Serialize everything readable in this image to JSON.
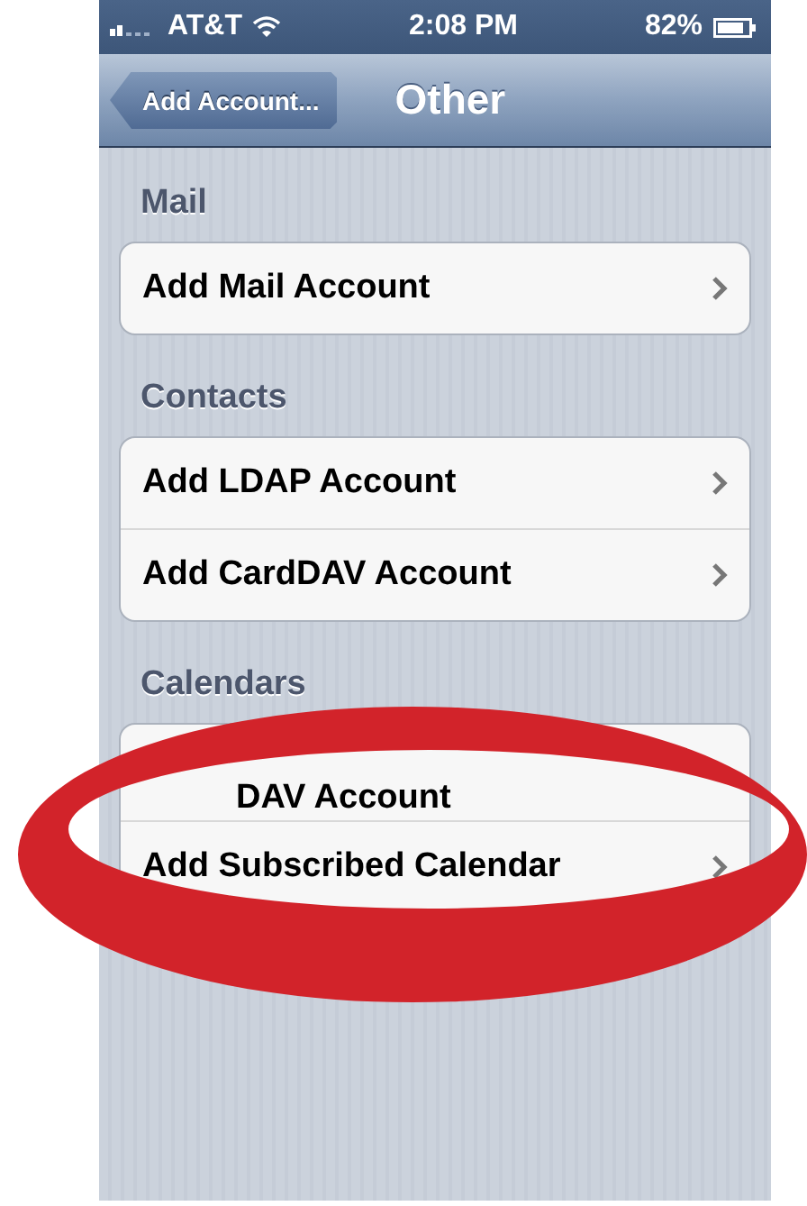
{
  "status_bar": {
    "carrier": "AT&T",
    "time": "2:08 PM",
    "battery": "82%"
  },
  "nav_bar": {
    "back": "Add Account...",
    "title": "Other"
  },
  "sections": [
    {
      "header": "Mail",
      "rows": [
        {
          "kind": "row",
          "label": "Add Mail Account",
          "partly_covered": false
        }
      ]
    },
    {
      "header": "Contacts",
      "rows": [
        {
          "kind": "row",
          "label": "Add LDAP Account",
          "partly_covered": false
        },
        {
          "kind": "row",
          "label": "Add CardDAV Account",
          "partly_covered": false
        }
      ]
    },
    {
      "header": "Calendars",
      "rows": [
        {
          "kind": "cut",
          "label": "DAV Account",
          "partly_covered": true
        },
        {
          "kind": "row",
          "label": "Add Subscribed Calendar",
          "partly_covered": true
        }
      ]
    }
  ]
}
